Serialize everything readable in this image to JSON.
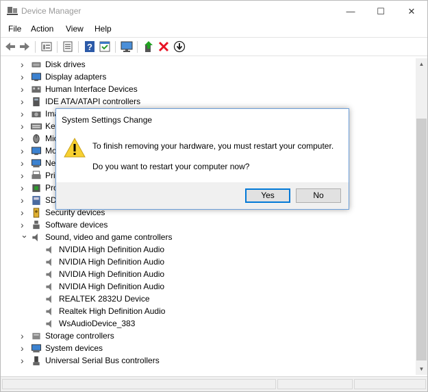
{
  "window": {
    "title": "Device Manager",
    "controls": {
      "minimize": "—",
      "maximize": "☐",
      "close": "✕"
    }
  },
  "menu": [
    "File",
    "Action",
    "View",
    "Help"
  ],
  "toolbar_icons": [
    "back-icon",
    "forward-icon",
    "properties-icon",
    "update-list-icon",
    "help-icon",
    "action-list-icon",
    "scan-hardware-icon",
    "enable-device-icon",
    "uninstall-icon",
    "update-driver-icon"
  ],
  "tree": [
    {
      "label": "Disk drives",
      "icon": "disk",
      "expanded": false,
      "level": 0
    },
    {
      "label": "Display adapters",
      "icon": "display",
      "expanded": false,
      "level": 0
    },
    {
      "label": "Human Interface Devices",
      "icon": "hid",
      "expanded": false,
      "level": 0
    },
    {
      "label": "IDE ATA/ATAPI controllers",
      "icon": "ide",
      "expanded": false,
      "level": 0
    },
    {
      "label": "Ima",
      "icon": "imaging",
      "expanded": false,
      "level": 0
    },
    {
      "label": "Key",
      "icon": "keyboard",
      "expanded": false,
      "level": 0
    },
    {
      "label": "Mic",
      "icon": "mouse",
      "expanded": false,
      "level": 0
    },
    {
      "label": "Mo",
      "icon": "monitor",
      "expanded": false,
      "level": 0
    },
    {
      "label": "Ne",
      "icon": "network",
      "expanded": false,
      "level": 0
    },
    {
      "label": "Prin",
      "icon": "print",
      "expanded": false,
      "level": 0
    },
    {
      "label": "Pro",
      "icon": "processor",
      "expanded": false,
      "level": 0
    },
    {
      "label": "SD",
      "icon": "sd",
      "expanded": false,
      "level": 0
    },
    {
      "label": "Security devices",
      "icon": "security",
      "expanded": false,
      "level": 0
    },
    {
      "label": "Software devices",
      "icon": "software",
      "expanded": false,
      "level": 0
    },
    {
      "label": "Sound, video and game controllers",
      "icon": "sound",
      "expanded": true,
      "level": 0
    },
    {
      "label": "NVIDIA High Definition Audio",
      "icon": "speaker",
      "level": 1
    },
    {
      "label": "NVIDIA High Definition Audio",
      "icon": "speaker",
      "level": 1
    },
    {
      "label": "NVIDIA High Definition Audio",
      "icon": "speaker",
      "level": 1
    },
    {
      "label": "NVIDIA High Definition Audio",
      "icon": "speaker",
      "level": 1
    },
    {
      "label": "REALTEK 2832U Device",
      "icon": "speaker",
      "level": 1
    },
    {
      "label": "Realtek High Definition Audio",
      "icon": "speaker",
      "level": 1
    },
    {
      "label": "WsAudioDevice_383",
      "icon": "speaker",
      "level": 1
    },
    {
      "label": "Storage controllers",
      "icon": "storage",
      "expanded": false,
      "level": 0
    },
    {
      "label": "System devices",
      "icon": "system",
      "expanded": false,
      "level": 0
    },
    {
      "label": "Universal Serial Bus controllers",
      "icon": "usb",
      "expanded": false,
      "level": 0
    }
  ],
  "dialog": {
    "title": "System Settings Change",
    "message1": "To finish removing your hardware, you must restart your computer.",
    "message2": "Do you want to restart your computer now?",
    "yes_label": "Yes",
    "no_label": "No"
  },
  "colors": {
    "accent": "#0078d7",
    "warning": "#f7d031",
    "uninstall_red": "#e81123"
  }
}
